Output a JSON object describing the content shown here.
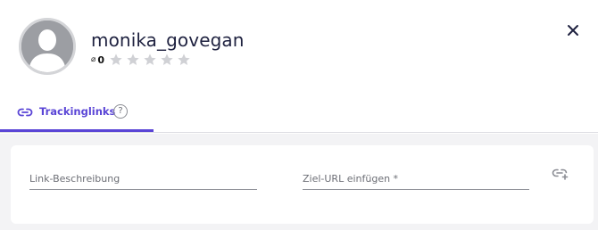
{
  "profile": {
    "username": "monika_govegan",
    "avg_symbol": "⌀",
    "rating_value": "0",
    "stars_filled": 0,
    "stars_total": 5
  },
  "tabs": [
    {
      "label": "Trackinglinks",
      "active": true,
      "help_symbol": "?"
    }
  ],
  "form": {
    "description": {
      "placeholder": "Link-Beschreibung",
      "value": ""
    },
    "url": {
      "placeholder": "Ziel-URL einfügen *",
      "value": ""
    }
  },
  "colors": {
    "accent": "#5a45d6",
    "star_empty": "#d0d1d5",
    "avatar": "#9c9ea3",
    "background": "#f3f3f5"
  },
  "icons": {
    "close": "close-icon",
    "tab": "link-icon",
    "help": "help-icon",
    "add": "add-link-icon"
  }
}
